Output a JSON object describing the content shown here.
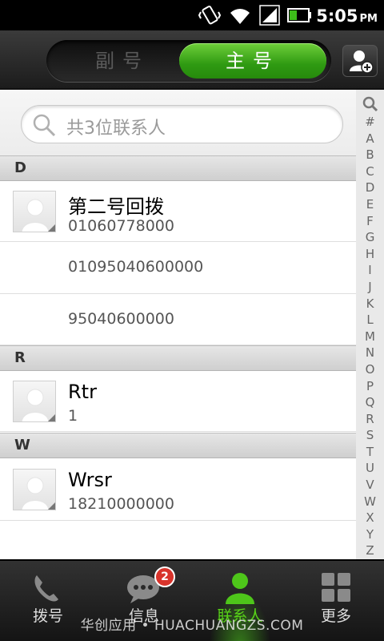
{
  "status_bar": {
    "time": "5:05",
    "ampm": "PM"
  },
  "header": {
    "segments": {
      "secondary": "副号",
      "primary": "主号",
      "selected": "primary"
    },
    "add_contact_icon": "add-contact-icon"
  },
  "search": {
    "placeholder": "共3位联系人"
  },
  "sections": [
    {
      "letter": "D"
    },
    {
      "letter": "R"
    },
    {
      "letter": "W"
    }
  ],
  "contacts": [
    {
      "name": "第二号回拨",
      "numbers": [
        "01060778000",
        "01095040600000",
        "95040600000"
      ]
    },
    {
      "name": "Rtr",
      "numbers": [
        "1"
      ]
    },
    {
      "name": "Wrsr",
      "numbers": [
        "18210000000"
      ]
    }
  ],
  "index": [
    "#",
    "A",
    "B",
    "C",
    "D",
    "E",
    "F",
    "G",
    "H",
    "I",
    "J",
    "K",
    "L",
    "M",
    "N",
    "O",
    "P",
    "Q",
    "R",
    "S",
    "T",
    "U",
    "V",
    "W",
    "X",
    "Y",
    "Z"
  ],
  "tabs": [
    {
      "label": "拨号",
      "icon": "phone-icon"
    },
    {
      "label": "信息",
      "icon": "message-icon",
      "badge": "2"
    },
    {
      "label": "联系人",
      "icon": "contact-icon",
      "active": true
    },
    {
      "label": "更多",
      "icon": "grid-icon"
    }
  ],
  "watermark": "华创应用 • HUACHUANGZS.COM",
  "colors": {
    "accent_green": "#58d318",
    "badge_red": "#d8332b"
  }
}
